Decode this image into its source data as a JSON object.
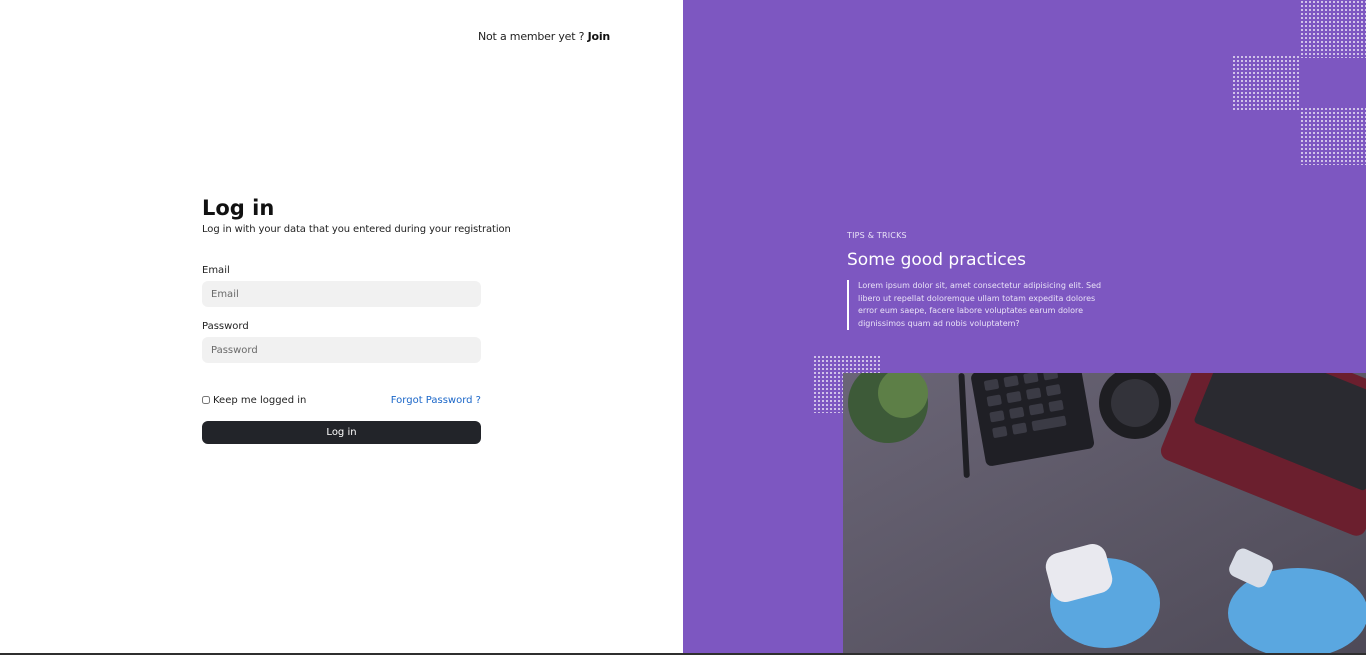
{
  "header": {
    "join_prompt": "Not a member yet ?",
    "join_link": "Join"
  },
  "login": {
    "title": "Log in",
    "subtitle": "Log in with your data that you entered during your registration",
    "email_label": "Email",
    "email_placeholder": "Email",
    "email_value": "",
    "password_label": "Password",
    "password_placeholder": "Password",
    "password_value": "",
    "remember_label": "Keep me logged in",
    "forgot_label": "Forgot Password ?",
    "submit_label": "Log in"
  },
  "aside": {
    "kicker": "TIPS & TRICKS",
    "heading": "Some good practices",
    "body": "Lorem ipsum dolor sit, amet consectetur adipisicing elit. Sed libero ut repellat doloremque ullam totam expedita dolores error eum saepe, facere labore voluptates earum dolore dignissimos quam ad nobis voluptatem?"
  },
  "colors": {
    "accent_purple": "#7d57c1",
    "button_dark": "#222429",
    "link_blue": "#1a66c8",
    "input_bg": "#f1f1f1"
  }
}
